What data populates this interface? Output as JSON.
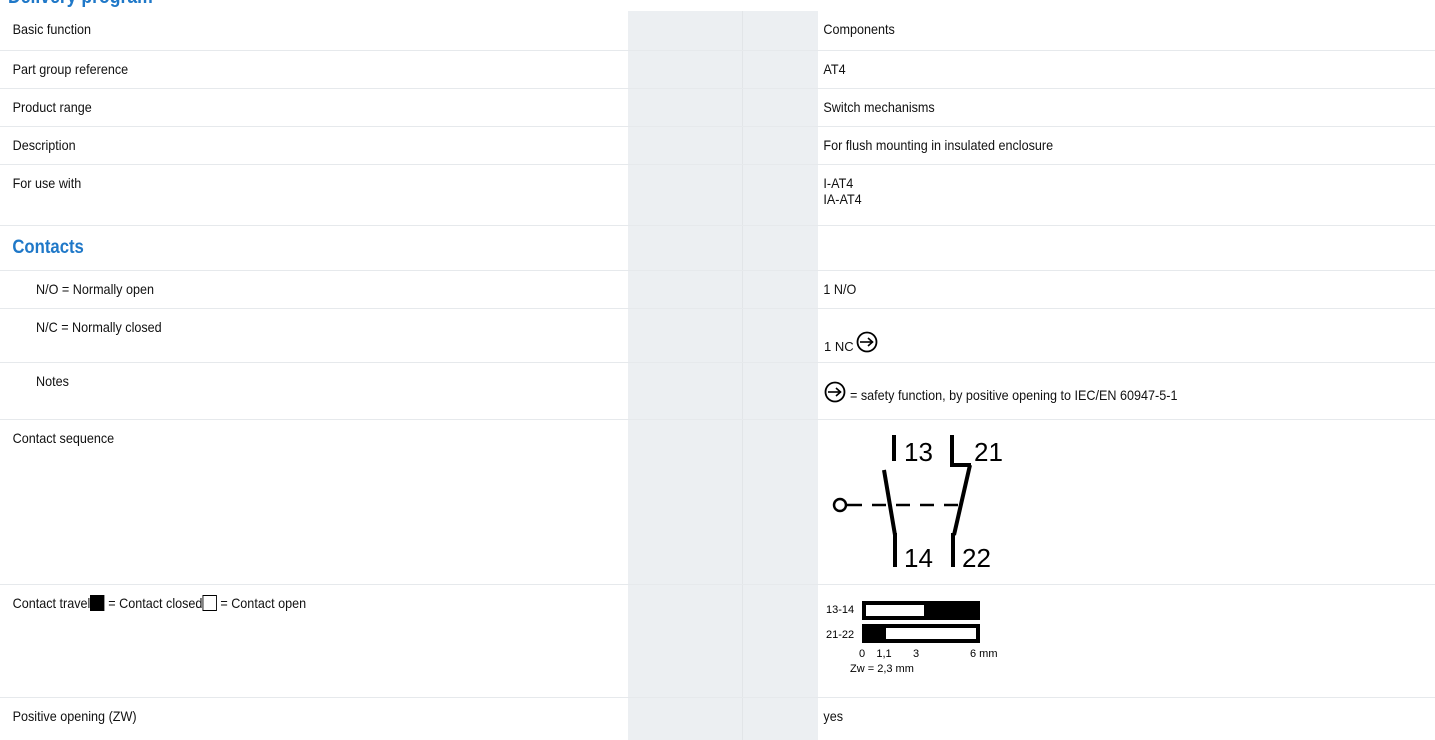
{
  "page_header": "Delivery program",
  "rows": {
    "basic_function": {
      "label": "Basic function",
      "value": "Components"
    },
    "part_group": {
      "label": "Part group reference",
      "value": "AT4"
    },
    "product_range": {
      "label": "Product range",
      "value": "Switch mechanisms"
    },
    "description": {
      "label": "Description",
      "value": "For flush mounting in insulated enclosure"
    },
    "for_use_with": {
      "label": "For use with",
      "value_1": "I-AT4",
      "value_2": "IA-AT4"
    },
    "contacts_section": "Contacts",
    "no": {
      "label": "N/O = Normally open",
      "value": "1 N/O"
    },
    "nc": {
      "label": "N/C = Normally closed",
      "value": "1 NC",
      "icon": "positive-opening-icon"
    },
    "notes": {
      "label": "Notes",
      "value": "= safety function, by positive opening to IEC/EN 60947-5-1",
      "icon": "positive-opening-icon"
    },
    "contact_sequence": {
      "label": "Contact sequence",
      "terminals": [
        "13",
        "14",
        "21",
        "22"
      ]
    },
    "contact_travel": {
      "label_prefix": "Contact travel",
      "label_closed": "= Contact closed",
      "label_open": "= Contact open",
      "rows": [
        "13-14",
        "21-22"
      ],
      "scale": [
        "0",
        "1,1",
        "3",
        "6 mm"
      ],
      "zw": "Zw = 2,3 mm"
    },
    "positive_opening": {
      "label": "Positive opening (ZW)",
      "value": "yes"
    }
  }
}
